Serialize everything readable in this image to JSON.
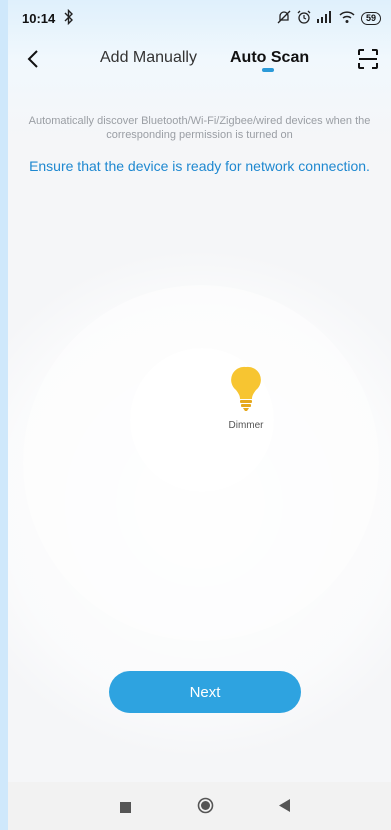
{
  "status_bar": {
    "time": "10:14",
    "battery": "59",
    "icons": [
      "bluetooth-icon",
      "mute-icon",
      "alarm-icon",
      "signal-icon",
      "wifi-icon",
      "battery-icon"
    ]
  },
  "nav": {
    "back_icon": "back-chevron-icon",
    "tabs": [
      {
        "label": "Add Manually",
        "active": false
      },
      {
        "label": "Auto Scan",
        "active": true
      }
    ],
    "scan_icon": "qr-scan-icon",
    "accent_color": "#2b9ad8"
  },
  "main": {
    "description": "Automatically discover Bluetooth/Wi-Fi/Zigbee/wired devices when the corresponding permission is turned on",
    "hint": "Ensure that the device is ready for network connection.",
    "hint_color": "#1e88d0",
    "devices": [
      {
        "name": "Dimmer",
        "icon": "light-bulb-icon",
        "icon_color": "#f7c531"
      }
    ],
    "next_label": "Next",
    "next_color": "#2ea3e0"
  },
  "system_nav": {
    "buttons": [
      "recent-apps-icon",
      "home-icon",
      "back-icon"
    ]
  }
}
